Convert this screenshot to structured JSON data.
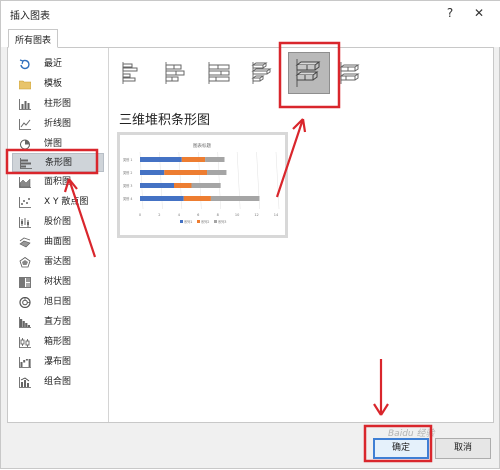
{
  "window": {
    "title": "插入图表",
    "help_symbol": "?",
    "close_symbol": "✕"
  },
  "tab": {
    "label": "所有图表"
  },
  "sidebar": {
    "items": [
      {
        "label": "最近",
        "icon": "recent-icon"
      },
      {
        "label": "模板",
        "icon": "folder-icon"
      },
      {
        "label": "柱形图",
        "icon": "column-chart-icon"
      },
      {
        "label": "折线图",
        "icon": "line-chart-icon"
      },
      {
        "label": "饼图",
        "icon": "pie-chart-icon"
      },
      {
        "label": "条形图",
        "icon": "bar-chart-icon",
        "selected": true
      },
      {
        "label": "面积图",
        "icon": "area-chart-icon"
      },
      {
        "label": "X Y 散点图",
        "icon": "scatter-chart-icon"
      },
      {
        "label": "股价图",
        "icon": "stock-chart-icon"
      },
      {
        "label": "曲面图",
        "icon": "surface-chart-icon"
      },
      {
        "label": "雷达图",
        "icon": "radar-chart-icon"
      },
      {
        "label": "树状图",
        "icon": "treemap-chart-icon"
      },
      {
        "label": "旭日图",
        "icon": "sunburst-chart-icon"
      },
      {
        "label": "直方图",
        "icon": "histogram-chart-icon"
      },
      {
        "label": "箱形图",
        "icon": "box-whisker-chart-icon"
      },
      {
        "label": "瀑布图",
        "icon": "waterfall-chart-icon"
      },
      {
        "label": "组合图",
        "icon": "combo-chart-icon"
      }
    ]
  },
  "subtypes": [
    {
      "icon": "clustered-bar-icon"
    },
    {
      "icon": "stacked-bar-icon"
    },
    {
      "icon": "100-stacked-bar-icon"
    },
    {
      "icon": "3d-clustered-bar-icon"
    },
    {
      "icon": "3d-stacked-bar-icon",
      "selected": true
    },
    {
      "icon": "3d-100-stacked-bar-icon"
    }
  ],
  "selected_title": "三维堆积条形图",
  "preview": {
    "chart_title": "图表标题",
    "categories": [
      "类别 1",
      "类别 2",
      "类别 3",
      "类别 4"
    ],
    "x_ticks": [
      "0",
      "2",
      "4",
      "6",
      "8",
      "10",
      "12",
      "14"
    ],
    "legend": [
      "系列1",
      "系列2",
      "系列3"
    ],
    "series_colors": [
      "#4472c4",
      "#ed7d31",
      "#a5a5a5"
    ]
  },
  "chart_data": {
    "type": "bar",
    "title": "图表标题",
    "categories": [
      "类别 1",
      "类别 2",
      "类别 3",
      "类别 4"
    ],
    "series": [
      {
        "name": "系列1",
        "values": [
          4.3,
          2.5,
          3.5,
          4.5
        ]
      },
      {
        "name": "系列2",
        "values": [
          2.4,
          4.4,
          1.8,
          2.8
        ]
      },
      {
        "name": "系列3",
        "values": [
          2,
          2,
          3,
          5
        ]
      }
    ],
    "xlim": [
      0,
      14
    ],
    "stacked": true
  },
  "buttons": {
    "ok": "确定",
    "cancel": "取消"
  },
  "watermark": "Baidu 经验"
}
